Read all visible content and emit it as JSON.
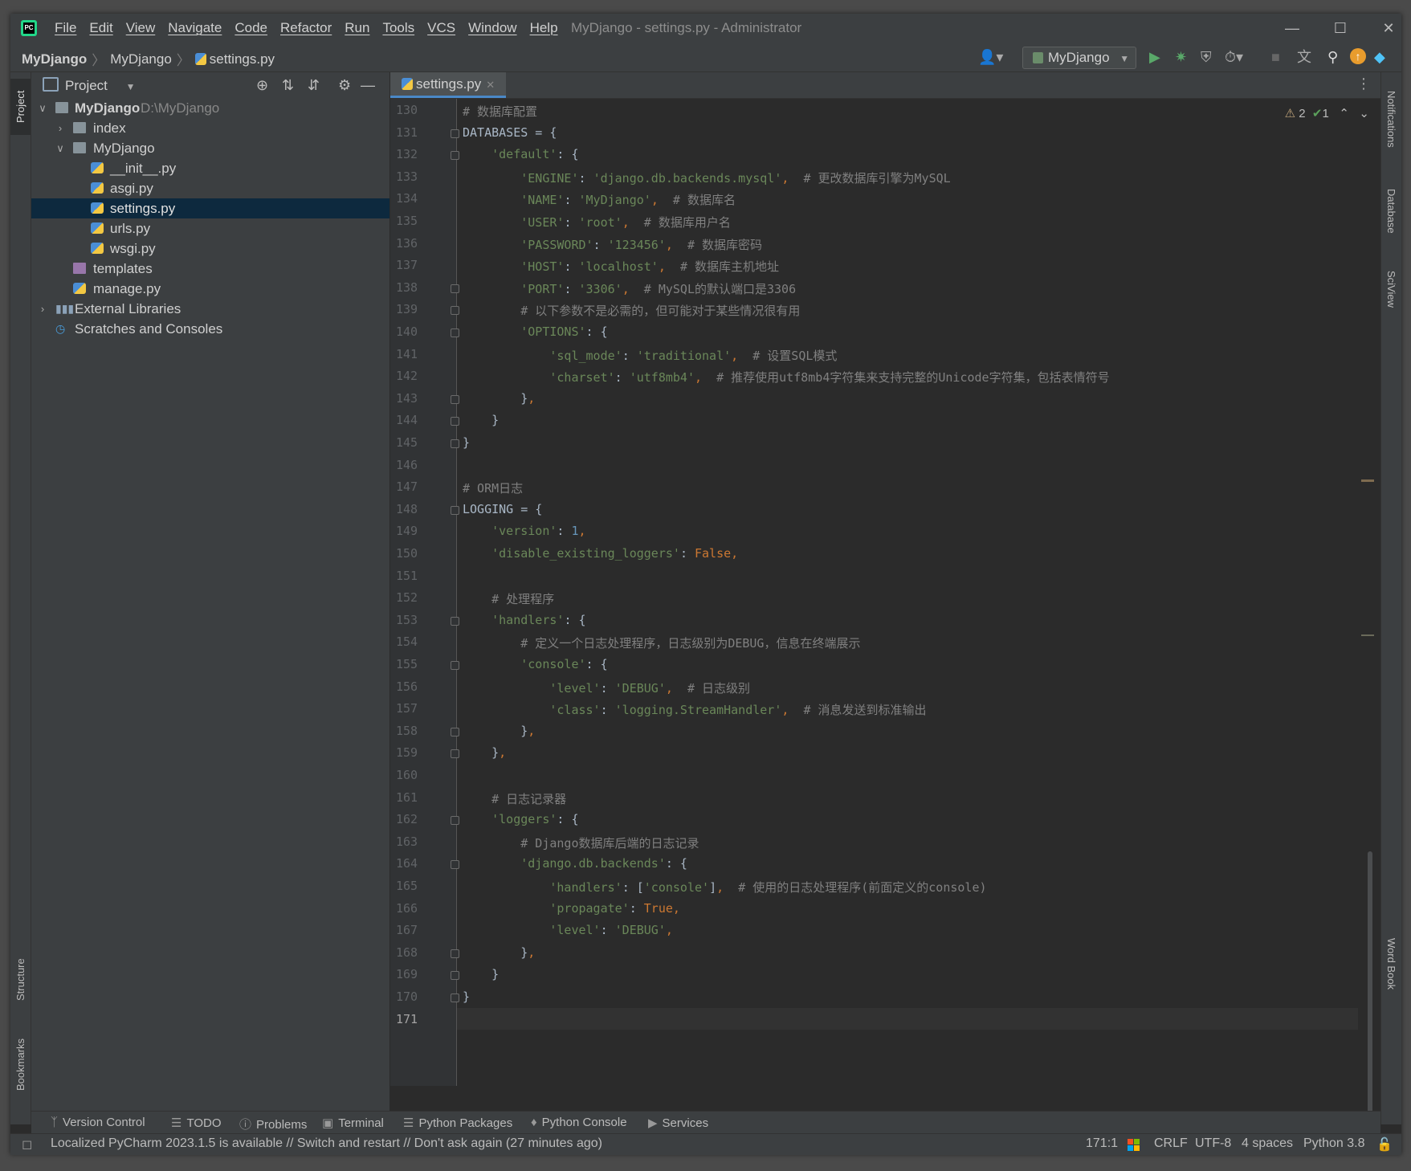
{
  "window": {
    "title": "MyDjango - settings.py - Administrator",
    "menu": [
      "File",
      "Edit",
      "View",
      "Navigate",
      "Code",
      "Refactor",
      "Run",
      "Tools",
      "VCS",
      "Window",
      "Help"
    ]
  },
  "navbar": {
    "crumbs": [
      "MyDjango",
      "MyDjango",
      "settings.py"
    ],
    "run_config": "MyDjango"
  },
  "project_panel": {
    "title": "Project",
    "tree": [
      {
        "label": "MyDjango",
        "extra": "D:\\MyDjango"
      },
      {
        "label": "index"
      },
      {
        "label": "MyDjango"
      },
      {
        "label": "__init__.py"
      },
      {
        "label": "asgi.py"
      },
      {
        "label": "settings.py"
      },
      {
        "label": "urls.py"
      },
      {
        "label": "wsgi.py"
      },
      {
        "label": "templates"
      },
      {
        "label": "manage.py"
      },
      {
        "label": "External Libraries"
      },
      {
        "label": "Scratches and Consoles"
      }
    ]
  },
  "side_tabs": {
    "left": [
      "Project",
      "Structure",
      "Bookmarks"
    ],
    "right": [
      "Notifications",
      "Database",
      "SciView",
      "Word Book"
    ]
  },
  "editor": {
    "tab": "settings.py",
    "warnings": "2",
    "ok": "1",
    "current_line": "171",
    "lines": [
      {
        "n": "130",
        "t": "# 数据库配置"
      },
      {
        "n": "131",
        "t": "DATABASES = {"
      },
      {
        "n": "132",
        "t": "    'default': {"
      },
      {
        "n": "133",
        "t": "        'ENGINE': 'django.db.backends.mysql',  # 更改数据库引擎为MySQL"
      },
      {
        "n": "134",
        "t": "        'NAME': 'MyDjango',  # 数据库名"
      },
      {
        "n": "135",
        "t": "        'USER': 'root',  # 数据库用户名"
      },
      {
        "n": "136",
        "t": "        'PASSWORD': '123456',  # 数据库密码"
      },
      {
        "n": "137",
        "t": "        'HOST': 'localhost',  # 数据库主机地址"
      },
      {
        "n": "138",
        "t": "        'PORT': '3306',  # MySQL的默认端口是3306"
      },
      {
        "n": "139",
        "t": "        # 以下参数不是必需的，但可能对于某些情况很有用"
      },
      {
        "n": "140",
        "t": "        'OPTIONS': {"
      },
      {
        "n": "141",
        "t": "            'sql_mode': 'traditional',  # 设置SQL模式"
      },
      {
        "n": "142",
        "t": "            'charset': 'utf8mb4',  # 推荐使用utf8mb4字符集来支持完整的Unicode字符集，包括表情符号"
      },
      {
        "n": "143",
        "t": "        },"
      },
      {
        "n": "144",
        "t": "    }"
      },
      {
        "n": "145",
        "t": "}"
      },
      {
        "n": "146",
        "t": ""
      },
      {
        "n": "147",
        "t": "# ORM日志"
      },
      {
        "n": "148",
        "t": "LOGGING = {"
      },
      {
        "n": "149",
        "t": "    'version': 1,"
      },
      {
        "n": "150",
        "t": "    'disable_existing_loggers': False,"
      },
      {
        "n": "151",
        "t": ""
      },
      {
        "n": "152",
        "t": "    # 处理程序"
      },
      {
        "n": "153",
        "t": "    'handlers': {"
      },
      {
        "n": "154",
        "t": "        # 定义一个日志处理程序，日志级别为DEBUG，信息在终端展示"
      },
      {
        "n": "155",
        "t": "        'console': {"
      },
      {
        "n": "156",
        "t": "            'level': 'DEBUG',  # 日志级别"
      },
      {
        "n": "157",
        "t": "            'class': 'logging.StreamHandler',  # 消息发送到标准输出"
      },
      {
        "n": "158",
        "t": "        },"
      },
      {
        "n": "159",
        "t": "    },"
      },
      {
        "n": "160",
        "t": ""
      },
      {
        "n": "161",
        "t": "    # 日志记录器"
      },
      {
        "n": "162",
        "t": "    'loggers': {"
      },
      {
        "n": "163",
        "t": "        # Django数据库后端的日志记录"
      },
      {
        "n": "164",
        "t": "        'django.db.backends': {"
      },
      {
        "n": "165",
        "t": "            'handlers': ['console'],  # 使用的日志处理程序(前面定义的console)"
      },
      {
        "n": "166",
        "t": "            'propagate': True,"
      },
      {
        "n": "167",
        "t": "            'level': 'DEBUG',"
      },
      {
        "n": "168",
        "t": "        },"
      },
      {
        "n": "169",
        "t": "    }"
      },
      {
        "n": "170",
        "t": "}"
      },
      {
        "n": "171",
        "t": ""
      }
    ]
  },
  "tool_windows": [
    "Version Control",
    "TODO",
    "Problems",
    "Terminal",
    "Python Packages",
    "Python Console",
    "Services"
  ],
  "status": {
    "message": "Localized PyCharm 2023.1.5 is available // Switch and restart // Don't ask again (27 minutes ago)",
    "position": "171:1",
    "line_sep": "CRLF",
    "encoding": "UTF-8",
    "indent": "4 spaces",
    "interpreter": "Python 3.8"
  },
  "colors": {
    "string": "#6a8759",
    "comment": "#808080",
    "keyword": "#cc7832",
    "number": "#6897bb",
    "identifier": "#a9b7c6",
    "selection": "#0d293e"
  }
}
